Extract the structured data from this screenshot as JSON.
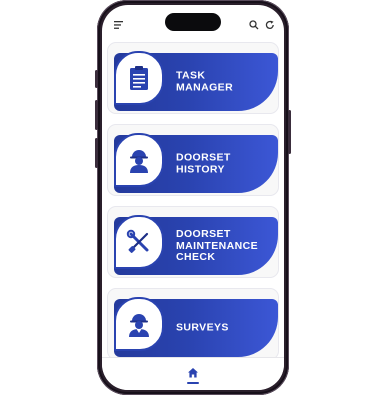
{
  "menu": {
    "items": [
      {
        "id": "task-manager",
        "label": "TASK\nMANAGER",
        "icon": "clipboard-icon"
      },
      {
        "id": "doorset-history",
        "label": "DOORSET\nHISTORY",
        "icon": "worker-helmet-icon"
      },
      {
        "id": "doorset-maintenance-check",
        "label": "DOORSET\nMAINTENANCE\nCHECK",
        "icon": "tools-wrench-screwdriver-icon"
      },
      {
        "id": "surveys",
        "label": "SURVEYS",
        "icon": "surveyor-icon"
      }
    ]
  },
  "topbar": {
    "icons": [
      "menu-icon",
      "search-icon",
      "refresh-icon"
    ]
  },
  "bottombar": {
    "icons": [
      "home-icon"
    ]
  },
  "colors": {
    "accent": "#2a43b0",
    "accent_light": "#3c57d6",
    "frame": "#2a1f2b"
  }
}
